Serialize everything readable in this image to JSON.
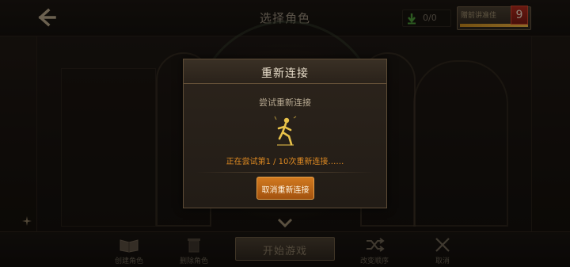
{
  "header": {
    "title": "选择角色",
    "download_count": "0/0",
    "extra_button_label": "赠前讲准佳",
    "level_badge": "9"
  },
  "footer": {
    "create_label": "创建角色",
    "delete_label": "删除角色",
    "start_label": "开始游戏",
    "shuffle_label": "改变顺序",
    "cancel_label": "取消"
  },
  "dialog": {
    "title": "重新连接",
    "message": "尝试重新连接",
    "status": "正在尝试第1 / 10次重新连接……",
    "cancel_button": "取消重新连接"
  },
  "icons": {
    "back": "arrow-left-icon",
    "download": "download-arrow-icon",
    "loading": "running-character-icon",
    "down": "chevron-down-icon",
    "create": "book-icon",
    "delete": "trash-icon",
    "shuffle": "shuffle-icon",
    "cancel": "close-icon"
  },
  "colors": {
    "accent_orange": "#df8a22",
    "button_orange": "#c06a18",
    "badge_red": "#b42b1d",
    "figure_gold": "#e8c24a"
  }
}
